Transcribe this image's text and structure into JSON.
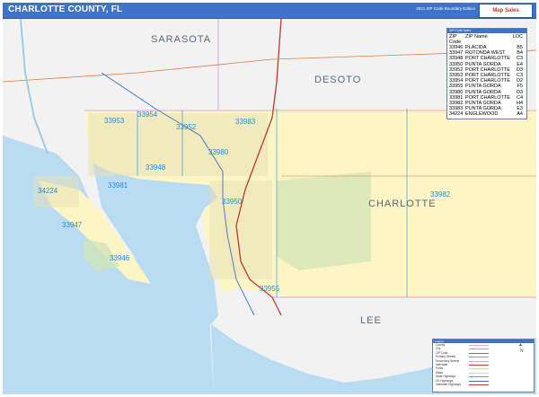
{
  "title": "CHARLOTTE COUNTY, FL",
  "edition": "2021 ZIP Code Boundary Edition",
  "brand": "Map Sales",
  "counties": {
    "sarasota": "SARASOTA",
    "desoto": "DESOTO",
    "charlotte": "CHARLOTTE",
    "lee": "LEE"
  },
  "zip_labels": [
    {
      "code": "33953"
    },
    {
      "code": "33954"
    },
    {
      "code": "33952"
    },
    {
      "code": "33983"
    },
    {
      "code": "33980"
    },
    {
      "code": "33948"
    },
    {
      "code": "34224"
    },
    {
      "code": "33981"
    },
    {
      "code": "33950"
    },
    {
      "code": "33947"
    },
    {
      "code": "33946"
    },
    {
      "code": "33955"
    },
    {
      "code": "33982"
    }
  ],
  "zip_table": {
    "panel_title": "ZIP Code Index",
    "headers": {
      "code": "ZIP Code",
      "name": "ZIP Name",
      "loc": "LOC"
    },
    "rows": [
      {
        "code": "33946",
        "name": "PLACIDA",
        "loc": "B5"
      },
      {
        "code": "33947",
        "name": "ROTONDA WEST",
        "loc": "B4"
      },
      {
        "code": "33948",
        "name": "PORT CHARLOTTE",
        "loc": "C3"
      },
      {
        "code": "33950",
        "name": "PUNTA GORDA",
        "loc": "E4"
      },
      {
        "code": "33952",
        "name": "PORT CHARLOTTE",
        "loc": "D3"
      },
      {
        "code": "33953",
        "name": "PORT CHARLOTTE",
        "loc": "C3"
      },
      {
        "code": "33954",
        "name": "PORT CHARLOTTE",
        "loc": "D2"
      },
      {
        "code": "33955",
        "name": "PUNTA GORDA",
        "loc": "F5"
      },
      {
        "code": "33980",
        "name": "PUNTA GORDA",
        "loc": "D3"
      },
      {
        "code": "33981",
        "name": "PORT CHARLOTTE",
        "loc": "C4"
      },
      {
        "code": "33982",
        "name": "PUNTA GORDA",
        "loc": "H4"
      },
      {
        "code": "33983",
        "name": "PUNTA GORDA",
        "loc": "E3"
      },
      {
        "code": "34224",
        "name": "ENGLEWOOD",
        "loc": "A4"
      }
    ]
  },
  "legend": {
    "title": "Legend",
    "items": [
      {
        "label": "County",
        "color": "#e7a5d8"
      },
      {
        "label": "City",
        "color": "#aaaaaa"
      },
      {
        "label": "ZIP Code",
        "color": "#1f8ee0"
      },
      {
        "label": "Primary Streets",
        "color": "#999999"
      },
      {
        "label": "Secondary Streets",
        "color": "#bbbbbb"
      },
      {
        "label": "Interstate",
        "color": "#c0392b"
      },
      {
        "label": "Parks",
        "color": "#cfe3b8"
      },
      {
        "label": "Water",
        "color": "#b9dcf2"
      },
      {
        "label": "State Highways",
        "color": "#e07b39"
      },
      {
        "label": "US Highways",
        "color": "#3f73c9"
      },
      {
        "label": "Interstate Highways",
        "color": "#c0392b"
      }
    ]
  },
  "colors": {
    "header": "#3f73c9",
    "charlotte_fill": "#fdf6c4",
    "other_land": "#f2f2f2",
    "water": "#b9dcf2",
    "zip_label": "#1f8ee0",
    "park": "#cfe3b8",
    "interstate": "#c0392b"
  },
  "compass_label": "N"
}
